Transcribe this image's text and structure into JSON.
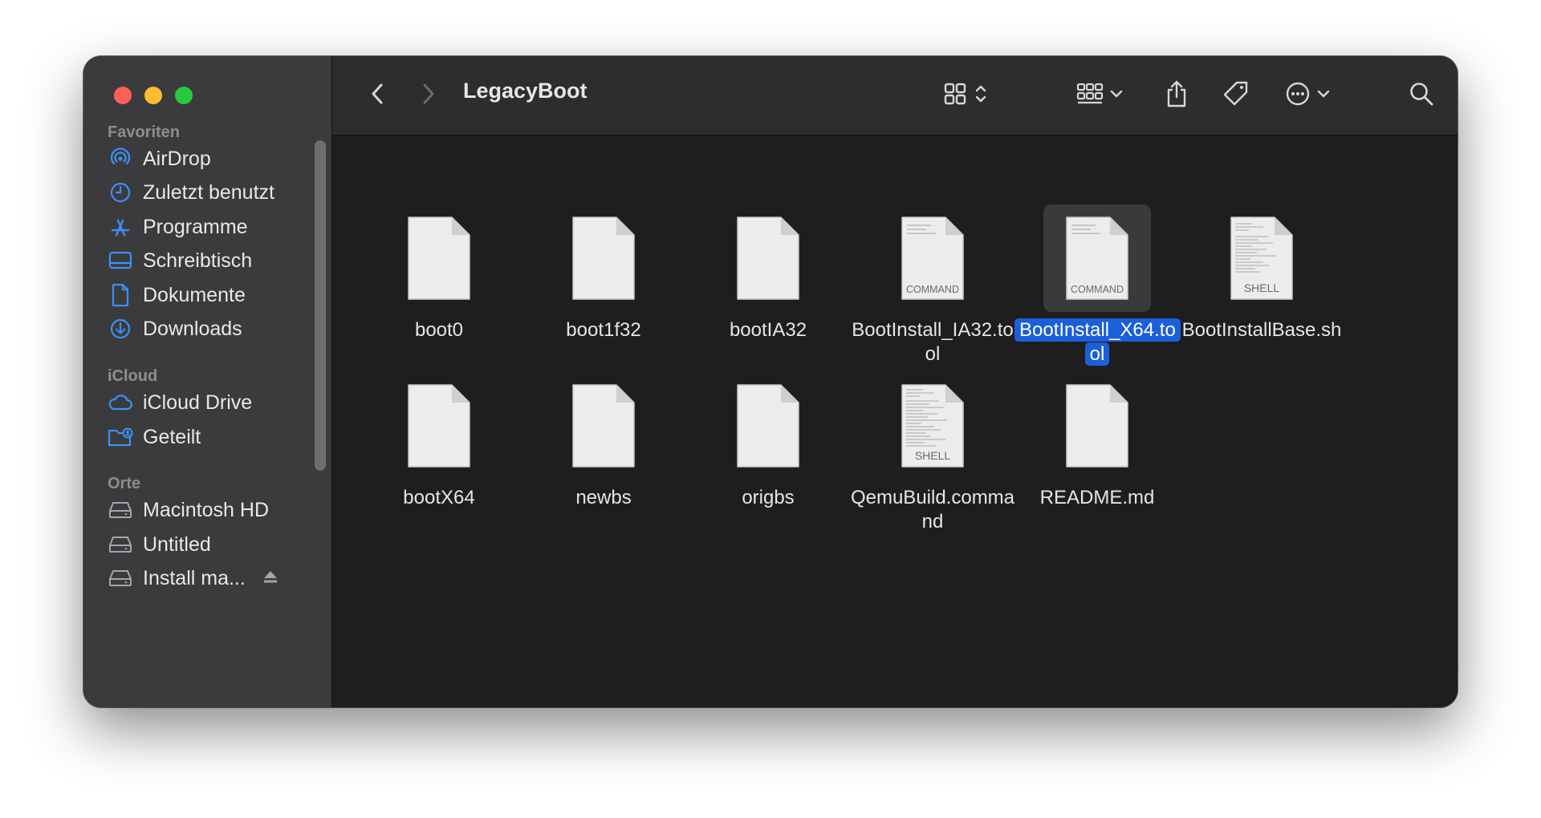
{
  "window": {
    "title": "LegacyBoot"
  },
  "sidebar": {
    "sections": [
      {
        "title": "Favoriten",
        "items": [
          {
            "label": "AirDrop",
            "icon": "airdrop-icon"
          },
          {
            "label": "Zuletzt benutzt",
            "icon": "clock-icon"
          },
          {
            "label": "Programme",
            "icon": "applications-icon"
          },
          {
            "label": "Schreibtisch",
            "icon": "desktop-icon"
          },
          {
            "label": "Dokumente",
            "icon": "document-icon"
          },
          {
            "label": "Downloads",
            "icon": "download-icon"
          }
        ]
      },
      {
        "title": "iCloud",
        "items": [
          {
            "label": "iCloud Drive",
            "icon": "cloud-icon"
          },
          {
            "label": "Geteilt",
            "icon": "shared-folder-icon"
          }
        ]
      },
      {
        "title": "Orte",
        "items": [
          {
            "label": "Macintosh HD",
            "icon": "disk-icon"
          },
          {
            "label": "Untitled",
            "icon": "disk-icon"
          },
          {
            "label": "Install ma...",
            "icon": "disk-icon"
          }
        ]
      }
    ]
  },
  "files": [
    {
      "name": "boot0",
      "badge": ""
    },
    {
      "name": "boot1f32",
      "badge": ""
    },
    {
      "name": "bootIA32",
      "badge": ""
    },
    {
      "name": "BootInstall_IA32.tool",
      "badge": "COMMAND"
    },
    {
      "name": "BootInstall_X64.tool",
      "badge": "COMMAND",
      "selected": true
    },
    {
      "name": "BootInstallBase.sh",
      "badge": "SHELL"
    },
    {
      "name": "bootX64",
      "badge": ""
    },
    {
      "name": "newbs",
      "badge": ""
    },
    {
      "name": "origbs",
      "badge": ""
    },
    {
      "name": "QemuBuild.command",
      "badge": "SHELL"
    },
    {
      "name": "README.md",
      "badge": ""
    }
  ],
  "colors": {
    "accent": "#1b5fd9",
    "sidebar_icon": "#3d8ff7",
    "sidebar_bg": "#3b3b3d",
    "content_bg": "#1e1e1e"
  }
}
